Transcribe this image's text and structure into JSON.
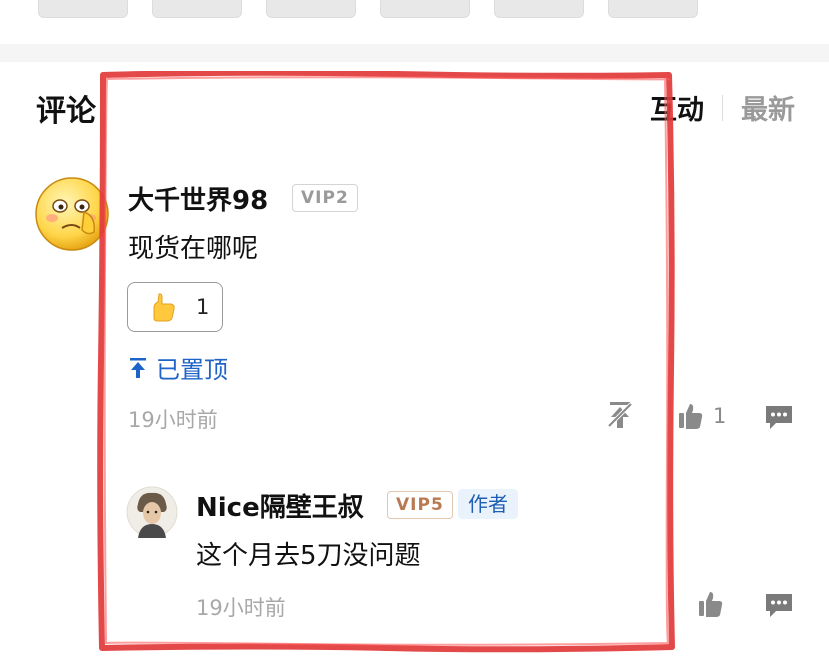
{
  "section": {
    "title": "评论"
  },
  "sort_tabs": {
    "active": "互动",
    "inactive": "最新"
  },
  "comment": {
    "username": "大千世界98",
    "vip": "VIP2",
    "text": "现货在哪呢",
    "reaction_count": "1",
    "pinned_label": "已置顶",
    "time": "19小时前",
    "like_count": "1"
  },
  "reply": {
    "username": "Nice隔壁王叔",
    "vip": "VIP5",
    "author_tag": "作者",
    "text": "这个月去5刀没问题",
    "time": "19小时前"
  },
  "colors": {
    "link_blue": "#1e63c8",
    "annotation_red": "#e23a3a",
    "gold_vip": "#b87a52"
  },
  "icons": [
    "emoji-avatar",
    "thumbs-up-emoji",
    "pin-top-icon",
    "unpin-icon",
    "thumbs-up-icon",
    "reply-bubble-icon"
  ]
}
